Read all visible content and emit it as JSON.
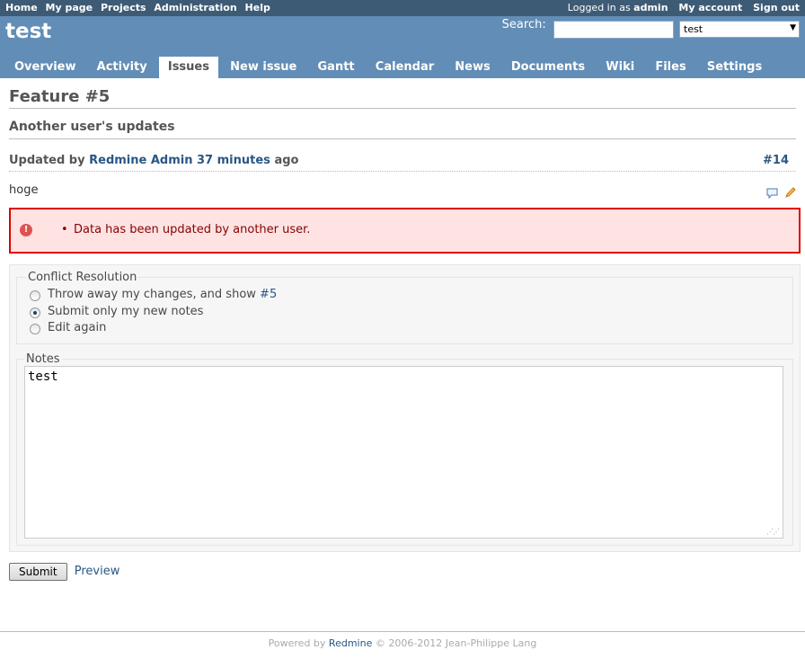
{
  "top_menu": {
    "left_items": [
      "Home",
      "My page",
      "Projects",
      "Administration",
      "Help"
    ],
    "logged_in_prefix": "Logged in as",
    "logged_in_user": "admin",
    "right_items": [
      "My account",
      "Sign out"
    ]
  },
  "header": {
    "project_title": "test",
    "search_label": "Search:",
    "search_value": "",
    "project_select_value": "test"
  },
  "main_menu": {
    "items": [
      "Overview",
      "Activity",
      "Issues",
      "New issue",
      "Gantt",
      "Calendar",
      "News",
      "Documents",
      "Wiki",
      "Files",
      "Settings"
    ],
    "selected": "Issues"
  },
  "issue": {
    "title": "Feature #5",
    "updates_heading": "Another user's updates",
    "journal": {
      "updated_by_prefix": "Updated by",
      "author": "Redmine Admin",
      "time_ago": "37 minutes",
      "suffix": "ago",
      "number": "#14",
      "body": "hoge"
    }
  },
  "error": {
    "message": "Data has been updated by another user."
  },
  "conflict": {
    "legend": "Conflict Resolution",
    "options": [
      {
        "label": "Throw away my changes, and show",
        "link": "#5",
        "checked": false
      },
      {
        "label": "Submit only my new notes",
        "checked": true
      },
      {
        "label": "Edit again",
        "checked": false
      }
    ]
  },
  "notes": {
    "legend": "Notes",
    "value": "test"
  },
  "actions": {
    "submit_label": "Submit",
    "preview_label": "Preview"
  },
  "footer": {
    "prefix": "Powered by",
    "link": "Redmine",
    "suffix": "© 2006-2012 Jean-Philippe Lang"
  },
  "colors": {
    "top_menu_bg": "#3E5B76",
    "header_bg": "#628DB6",
    "link": "#2A5685",
    "error_border": "#dd0000",
    "error_bg": "#ffe3e3"
  }
}
